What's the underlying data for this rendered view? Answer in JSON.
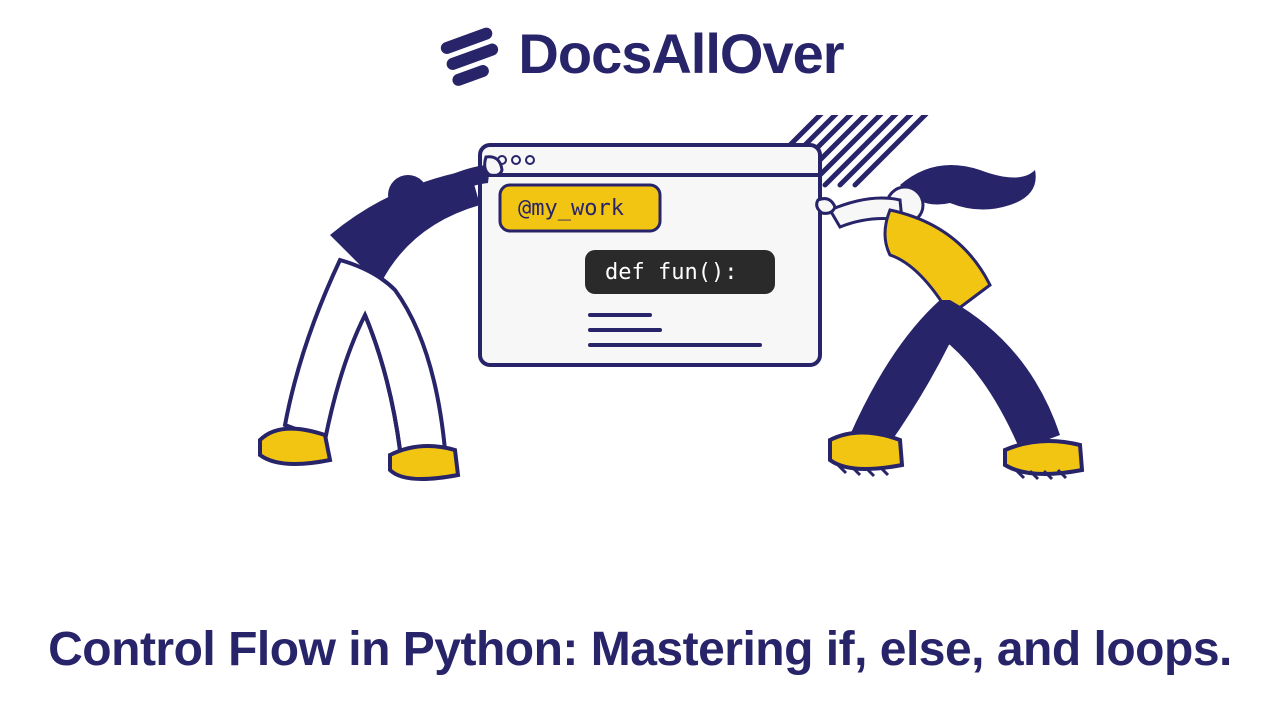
{
  "brand": "DocsAllOver",
  "title": "Control Flow in Python: Mastering if, else, and loops.",
  "illustration": {
    "decorator_label": "@my_work",
    "function_def": "def fun():"
  },
  "colors": {
    "primary": "#28246a",
    "accent": "#f2c512",
    "dark_pill": "#2a2a2a",
    "window_bg": "#f7f7f7"
  }
}
